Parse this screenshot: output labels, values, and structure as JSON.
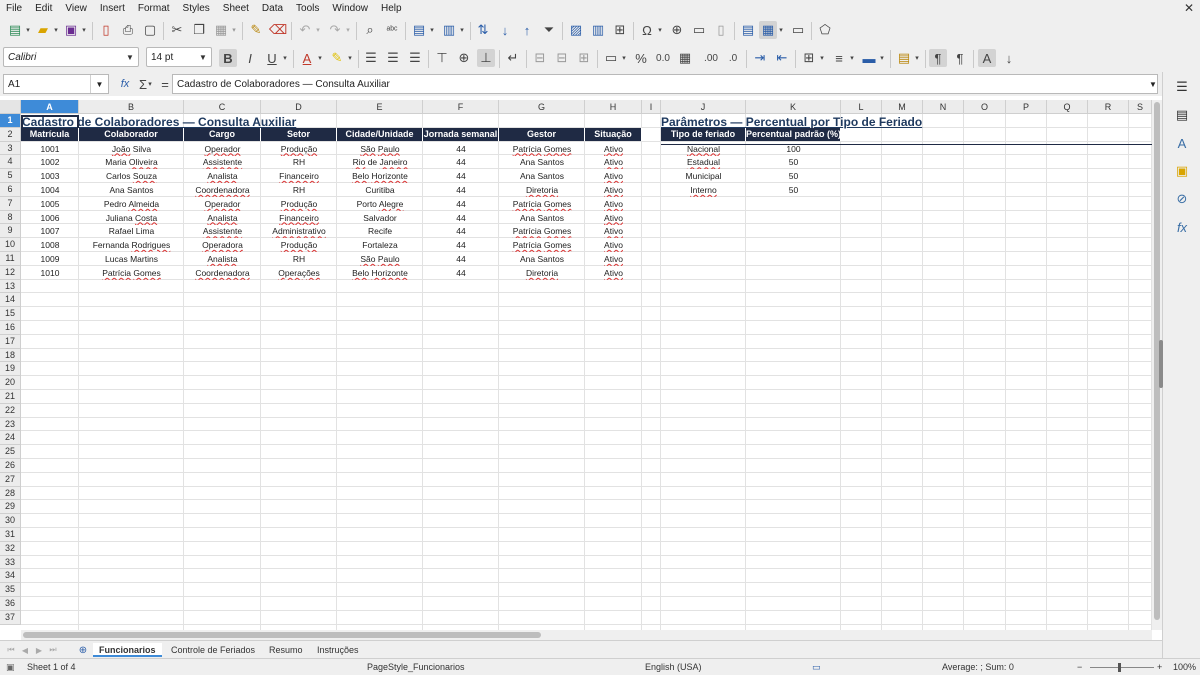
{
  "menu": [
    "File",
    "Edit",
    "View",
    "Insert",
    "Format",
    "Styles",
    "Sheet",
    "Data",
    "Tools",
    "Window",
    "Help"
  ],
  "toolbar": {
    "font_name": "Calibri",
    "font_size": "14 pt"
  },
  "formula_bar": {
    "cell_ref": "A1",
    "content": "Cadastro de Colaboradores — Consulta Auxiliar",
    "fx": "fx",
    "sigma": "Σ",
    "equals": "="
  },
  "columns": [
    "A",
    "B",
    "C",
    "D",
    "E",
    "F",
    "G",
    "H",
    "I",
    "J",
    "K",
    "L",
    "M",
    "N",
    "O",
    "P",
    "Q",
    "R",
    "S"
  ],
  "rows": [
    "1",
    "2",
    "3",
    "4",
    "5",
    "6",
    "7",
    "8",
    "9",
    "10",
    "11",
    "12",
    "13",
    "14",
    "15",
    "16",
    "17",
    "18",
    "19",
    "20",
    "21",
    "22",
    "23",
    "24",
    "25",
    "26",
    "27",
    "28",
    "29",
    "30",
    "31",
    "32",
    "33",
    "34",
    "35",
    "36",
    "37"
  ],
  "employees": {
    "title": "Cadastro de Colaboradores — Consulta Auxiliar",
    "headers": [
      "Matrícula",
      "Colaborador",
      "Cargo",
      "Setor",
      "Cidade/Unidade",
      "Jornada semanal",
      "Gestor",
      "Situação"
    ],
    "rows": [
      [
        "1001",
        "João Silva",
        "Operador",
        "Produção",
        "São Paulo",
        "44",
        "Patrícia Gomes",
        "Ativo"
      ],
      [
        "1002",
        "Maria Oliveira",
        "Assistente",
        "RH",
        "Rio de Janeiro",
        "44",
        "Ana Santos",
        "Ativo"
      ],
      [
        "1003",
        "Carlos Souza",
        "Analista",
        "Financeiro",
        "Belo Horizonte",
        "44",
        "Ana Santos",
        "Ativo"
      ],
      [
        "1004",
        "Ana Santos",
        "Coordenadora",
        "RH",
        "Curitiba",
        "44",
        "Diretoria",
        "Ativo"
      ],
      [
        "1005",
        "Pedro Almeida",
        "Operador",
        "Produção",
        "Porto Alegre",
        "44",
        "Patrícia Gomes",
        "Ativo"
      ],
      [
        "1006",
        "Juliana Costa",
        "Analista",
        "Financeiro",
        "Salvador",
        "44",
        "Ana Santos",
        "Ativo"
      ],
      [
        "1007",
        "Rafael Lima",
        "Assistente",
        "Administrativo",
        "Recife",
        "44",
        "Patrícia Gomes",
        "Ativo"
      ],
      [
        "1008",
        "Fernanda Rodrigues",
        "Operadora",
        "Produção",
        "Fortaleza",
        "44",
        "Patrícia Gomes",
        "Ativo"
      ],
      [
        "1009",
        "Lucas Martins",
        "Analista",
        "RH",
        "São Paulo",
        "44",
        "Ana Santos",
        "Ativo"
      ],
      [
        "1010",
        "Patrícia Gomes",
        "Coordenadora",
        "Operações",
        "Belo Horizonte",
        "44",
        "Diretoria",
        "Ativo"
      ]
    ]
  },
  "holiday_params": {
    "title": "Parâmetros — Percentual por Tipo de Feriado",
    "headers": [
      "Tipo de feriado",
      "Percentual padrão (%)"
    ],
    "rows": [
      [
        "Nacional",
        "100"
      ],
      [
        "Estadual",
        "50"
      ],
      [
        "Municipal",
        "50"
      ],
      [
        "Interno",
        "50"
      ]
    ]
  },
  "sheet_tabs": [
    "Funcionarios",
    "Controle de Feriados",
    "Resumo",
    "Instruções"
  ],
  "active_tab": "Funcionarios",
  "status": {
    "sheet": "Sheet 1 of 4",
    "page_style": "PageStyle_Funcionarios",
    "language": "English (USA)",
    "summary": "Average: ; Sum: 0",
    "zoom": "100%"
  },
  "colors": {
    "header_fill": "#1f2a44",
    "title_color": "#1f3a5f",
    "selection": "#3e8bd8"
  }
}
